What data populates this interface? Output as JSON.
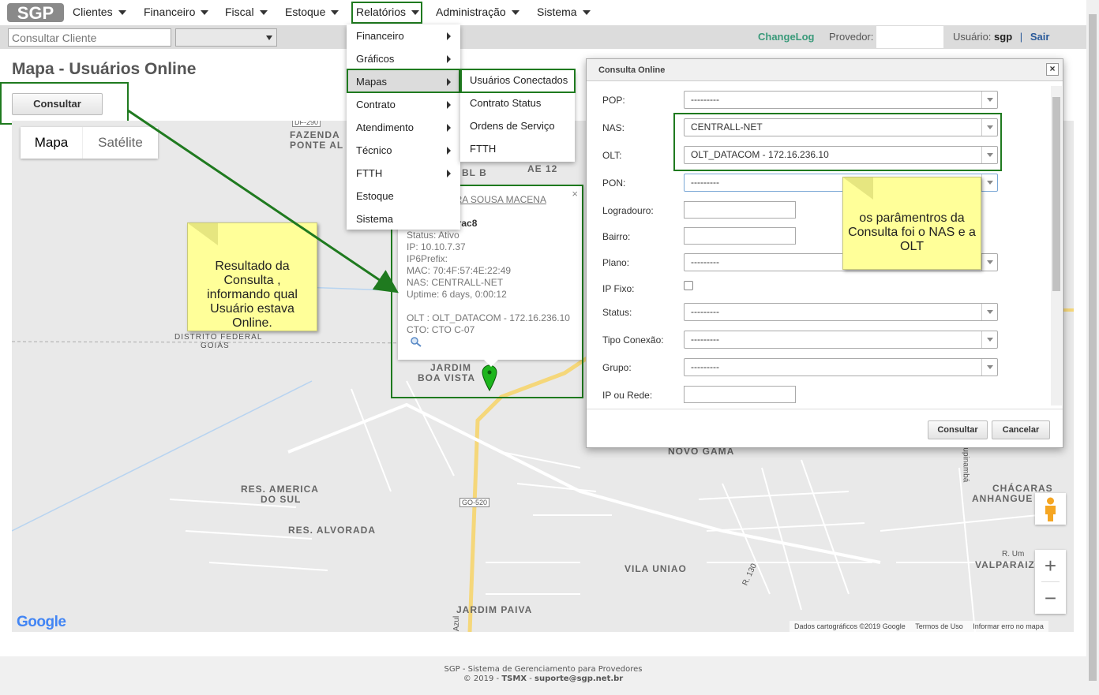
{
  "app": {
    "logo_text": "SGP"
  },
  "nav": {
    "items": [
      "Clientes",
      "Financeiro",
      "Fiscal",
      "Estoque",
      "Relatórios",
      "Administração",
      "Sistema"
    ]
  },
  "toolbar": {
    "search_placeholder": "Consultar Cliente",
    "changelog": "ChangeLog",
    "provedor_label": "Provedor:",
    "usuario_label": "Usuário:",
    "usuario_name": "sgp",
    "sair": "Sair"
  },
  "page": {
    "title": "Mapa - Usuários Online",
    "consultar_button": "Consultar"
  },
  "map": {
    "tabs": [
      "Mapa",
      "Satélite"
    ],
    "labels": {
      "fazenda": "FAZENDA",
      "ponte_alta": "PONTE AL",
      "bl_b": "BL B",
      "ae_12": "AE 12",
      "df": "DISTRITO FEDERAL",
      "goias": "GOIÁS",
      "jardim_boa_vista_1": "JARDIM",
      "jardim_boa_vista_2": "BOA VISTA",
      "res_america_1": "RES. AMERICA",
      "res_america_2": "DO SUL",
      "res_alvorada": "RES. ALVORADA",
      "novo_gama": "NOVO GAMA",
      "vila_uniao": "VILA UNIAO",
      "jardim_paiva": "JARDIM PAIVA",
      "chacaras_1": "CHÁCARAS",
      "chacaras_2": "ANHANGUE",
      "valparaiz": "VALPARAIZ",
      "go520": "GO-520",
      "df290": "DF-290",
      "r130": "R. 130",
      "tupinamba": "Tupinambá",
      "r_um": "R. Um",
      "azul": "Azul"
    },
    "attribution": [
      "Dados cartográficos ©2019 Google",
      "Termos de Uso",
      "Informar erro no mapa"
    ],
    "google": "Google",
    "zoom_in": "+",
    "zoom_out": "−"
  },
  "menu": {
    "relatorios": [
      {
        "label": "Financeiro",
        "has_sub": true
      },
      {
        "label": "Gráficos",
        "has_sub": true
      },
      {
        "label": "Mapas",
        "has_sub": true
      },
      {
        "label": "Contrato",
        "has_sub": true
      },
      {
        "label": "Atendimento",
        "has_sub": true
      },
      {
        "label": "Técnico",
        "has_sub": true
      },
      {
        "label": "FTTH",
        "has_sub": true
      },
      {
        "label": "Estoque",
        "has_sub": false
      },
      {
        "label": "Sistema",
        "has_sub": false
      }
    ],
    "mapas_sub": [
      "Usuários Conectados",
      "Contrato Status",
      "Ordens de Serviço",
      "FTTH"
    ]
  },
  "popup": {
    "title": "334 - RAYARA SOUSA MACENA",
    "login": "Login: rayarac8",
    "lines": [
      "Status: Ativo",
      "IP: 10.10.7.37",
      "IP6Prefix:",
      "MAC: 70:4F:57:4E:22:49",
      "NAS: CENTRALL-NET",
      "Uptime: 6 days, 0:00:12"
    ],
    "olt": "OLT : OLT_DATACOM - 172.16.236.10",
    "cto": "CTO: CTO C-07",
    "close": "×"
  },
  "dialog": {
    "title": "Consulta Online",
    "close": "×",
    "fields": {
      "pop": {
        "label": "POP:",
        "value": "---------"
      },
      "nas": {
        "label": "NAS:",
        "value": "CENTRALL-NET"
      },
      "olt": {
        "label": "OLT:",
        "value": "OLT_DATACOM - 172.16.236.10"
      },
      "pon": {
        "label": "PON:",
        "value": "---------"
      },
      "logradouro": {
        "label": "Logradouro:"
      },
      "bairro": {
        "label": "Bairro:"
      },
      "plano": {
        "label": "Plano:",
        "value": "---------"
      },
      "ipfixo": {
        "label": "IP Fixo:"
      },
      "status": {
        "label": "Status:",
        "value": "---------"
      },
      "tipo": {
        "label": "Tipo Conexão:",
        "value": "---------"
      },
      "grupo": {
        "label": "Grupo:",
        "value": "---------"
      },
      "iprede": {
        "label": "IP ou Rede:"
      }
    },
    "buttons": {
      "consultar": "Consultar",
      "cancelar": "Cancelar"
    }
  },
  "notes": {
    "left": "Resultado da Consulta , informando qual Usuário estava Online.",
    "right": "os parâmentros da Consulta foi o NAS e a OLT"
  },
  "footer": {
    "line1": "SGP - Sistema de Gerenciamento para Provedores",
    "line2_prefix": "© 2019 - ",
    "company": "TSMX",
    "line2_sep": " - ",
    "email": "suporte@sgp.net.br"
  },
  "colors": {
    "highlight": "#1f7a1f",
    "note": "#ffff99",
    "accent": "#3a9a7a"
  }
}
